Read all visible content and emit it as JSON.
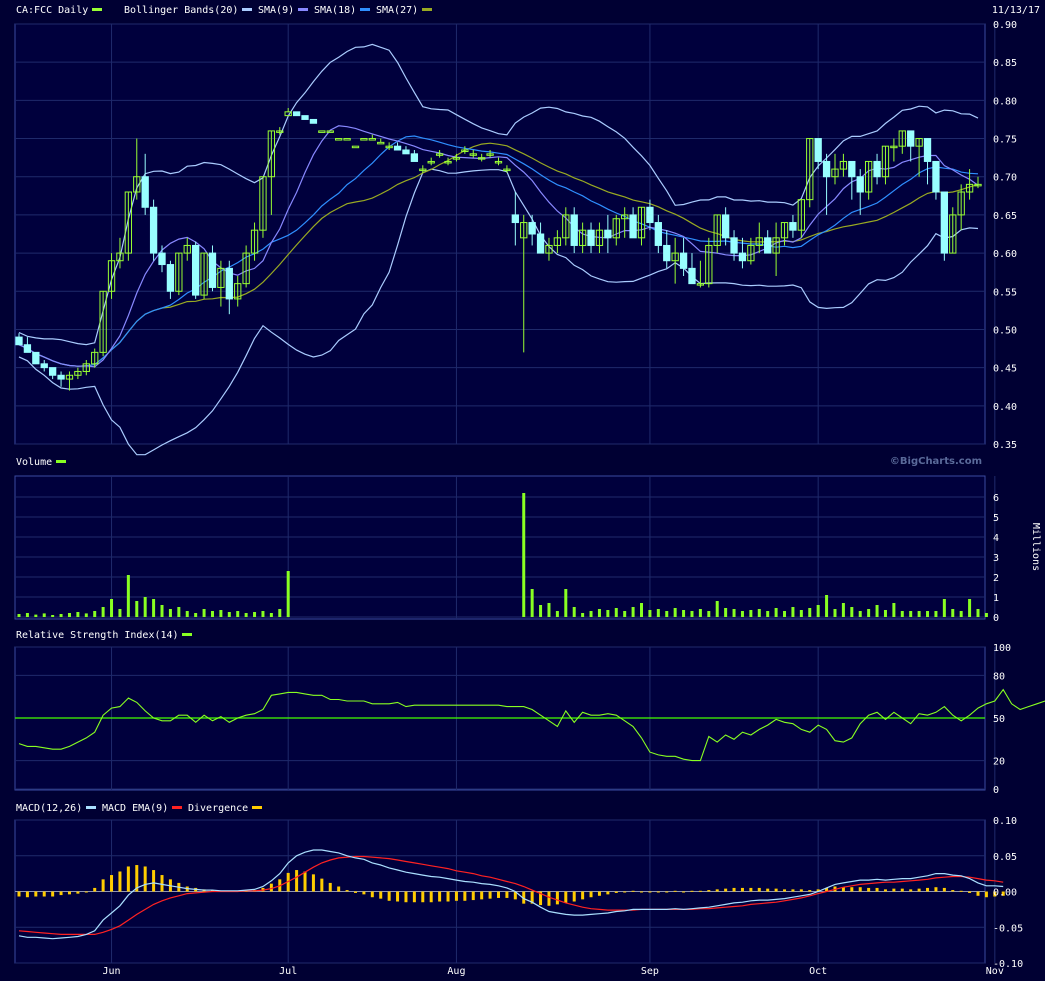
{
  "colors": {
    "background": "#000033",
    "panel_bg": "#00003d",
    "grid": "#1f2a6b",
    "up_candle": "#99ff33",
    "down_candle": "#99ffff",
    "bollinger": "#aaccff",
    "sma9": "#8888ff",
    "sma18": "#2f8fff",
    "sma27": "#99aa22",
    "volume": "#88ff22",
    "rsi": "#88ff22",
    "rsi_midline": "#44ff00",
    "macd": "#aadfff",
    "macd_ema": "#ff2222",
    "divergence": "#ffcc00"
  },
  "date_label": "11/13/17",
  "watermark": "©BigCharts.com",
  "x_labels": [
    {
      "i": 11,
      "text": "Jun"
    },
    {
      "i": 32,
      "text": "Jul"
    },
    {
      "i": 52,
      "text": "Aug"
    },
    {
      "i": 75,
      "text": "Sep"
    },
    {
      "i": 95,
      "text": "Oct"
    },
    {
      "i": 116,
      "text": "Nov"
    }
  ],
  "panels": {
    "price": {
      "legend": [
        {
          "text": "CA:FCC Daily",
          "color": "#99ff33"
        },
        {
          "text": "Bollinger Bands(20)",
          "color": "#aaccff"
        },
        {
          "text": "SMA(9)",
          "color": "#8888ff"
        },
        {
          "text": "SMA(18)",
          "color": "#2f8fff"
        },
        {
          "text": "SMA(27)",
          "color": "#99aa22"
        }
      ],
      "ymin": 0.35,
      "ymax": 0.9,
      "ticks": [
        "0.90",
        "0.85",
        "0.80",
        "0.75",
        "0.70",
        "0.65",
        "0.60",
        "0.55",
        "0.50",
        "0.45",
        "0.40",
        "0.35"
      ]
    },
    "volume": {
      "legend": [
        {
          "text": "Volume",
          "color": "#88ff22"
        }
      ],
      "ymax": 6.5,
      "ticks": [
        "6",
        "5",
        "4",
        "3",
        "2",
        "1",
        "0"
      ],
      "unit": "Millions"
    },
    "rsi": {
      "legend": [
        {
          "text": "Relative Strength Index(14)",
          "color": "#88ff22"
        }
      ],
      "ticks": [
        "100",
        "80",
        "50",
        "20",
        "0"
      ]
    },
    "macd": {
      "legend": [
        {
          "text": "MACD(12,26)",
          "color": "#aadfff"
        },
        {
          "text": "MACD EMA(9)",
          "color": "#ff2222"
        },
        {
          "text": "Divergence",
          "color": "#ffcc00"
        }
      ],
      "ymin": -0.1,
      "ymax": 0.1,
      "ticks": [
        "0.10",
        "0.05",
        "0.00",
        "-0.05",
        "-0.10"
      ]
    }
  },
  "chart_data": [
    {
      "type": "candlestick",
      "title": "CA:FCC Daily",
      "note": "Bollinger Bands(20), SMA(9), SMA(18), SMA(27)",
      "ohlc": [
        [
          0.49,
          0.495,
          0.48,
          0.48
        ],
        [
          0.48,
          0.49,
          0.47,
          0.47
        ],
        [
          0.47,
          0.47,
          0.455,
          0.455
        ],
        [
          0.455,
          0.46,
          0.445,
          0.45
        ],
        [
          0.45,
          0.45,
          0.435,
          0.44
        ],
        [
          0.44,
          0.445,
          0.425,
          0.435
        ],
        [
          0.435,
          0.445,
          0.42,
          0.44
        ],
        [
          0.44,
          0.45,
          0.435,
          0.445
        ],
        [
          0.445,
          0.46,
          0.44,
          0.455
        ],
        [
          0.455,
          0.475,
          0.45,
          0.47
        ],
        [
          0.47,
          0.55,
          0.465,
          0.55
        ],
        [
          0.55,
          0.6,
          0.54,
          0.59
        ],
        [
          0.59,
          0.62,
          0.58,
          0.6
        ],
        [
          0.6,
          0.68,
          0.59,
          0.68
        ],
        [
          0.68,
          0.75,
          0.67,
          0.7
        ],
        [
          0.7,
          0.73,
          0.65,
          0.66
        ],
        [
          0.66,
          0.67,
          0.59,
          0.6
        ],
        [
          0.6,
          0.61,
          0.575,
          0.585
        ],
        [
          0.585,
          0.59,
          0.54,
          0.55
        ],
        [
          0.55,
          0.6,
          0.545,
          0.6
        ],
        [
          0.6,
          0.62,
          0.59,
          0.61
        ],
        [
          0.61,
          0.615,
          0.54,
          0.545
        ],
        [
          0.545,
          0.6,
          0.54,
          0.6
        ],
        [
          0.6,
          0.61,
          0.55,
          0.555
        ],
        [
          0.555,
          0.59,
          0.53,
          0.58
        ],
        [
          0.58,
          0.59,
          0.52,
          0.54
        ],
        [
          0.54,
          0.57,
          0.53,
          0.56
        ],
        [
          0.56,
          0.61,
          0.555,
          0.6
        ],
        [
          0.6,
          0.64,
          0.59,
          0.63
        ],
        [
          0.63,
          0.7,
          0.62,
          0.7
        ],
        [
          0.7,
          0.76,
          0.65,
          0.76
        ],
        [
          0.76,
          0.765,
          0.755,
          0.76
        ],
        [
          0.78,
          0.79,
          0.785,
          0.785
        ],
        [
          0.785,
          0.785,
          0.78,
          0.78
        ],
        [
          0.78,
          0.78,
          0.775,
          0.775
        ],
        [
          0.775,
          0.775,
          0.77,
          0.77
        ],
        [
          0.76,
          0.76,
          0.76,
          0.76
        ],
        [
          0.76,
          0.76,
          0.76,
          0.76
        ],
        [
          0.75,
          0.75,
          0.75,
          0.75
        ],
        [
          0.75,
          0.75,
          0.75,
          0.75
        ],
        [
          0.74,
          0.74,
          0.74,
          0.74
        ],
        [
          0.75,
          0.75,
          0.75,
          0.75
        ],
        [
          0.75,
          0.755,
          0.75,
          0.75
        ],
        [
          0.745,
          0.75,
          0.745,
          0.745
        ],
        [
          0.74,
          0.745,
          0.735,
          0.74
        ],
        [
          0.74,
          0.745,
          0.735,
          0.735
        ],
        [
          0.735,
          0.74,
          0.73,
          0.73
        ],
        [
          0.73,
          0.735,
          0.725,
          0.72
        ],
        [
          0.71,
          0.715,
          0.705,
          0.71
        ],
        [
          0.72,
          0.725,
          0.715,
          0.72
        ],
        [
          0.73,
          0.735,
          0.725,
          0.73
        ],
        [
          0.72,
          0.725,
          0.715,
          0.72
        ],
        [
          0.725,
          0.73,
          0.72,
          0.725
        ],
        [
          0.735,
          0.74,
          0.73,
          0.735
        ],
        [
          0.73,
          0.735,
          0.725,
          0.73
        ],
        [
          0.725,
          0.73,
          0.72,
          0.725
        ],
        [
          0.73,
          0.735,
          0.725,
          0.73
        ],
        [
          0.72,
          0.725,
          0.715,
          0.72
        ],
        [
          0.71,
          0.715,
          0.705,
          0.71
        ],
        [
          0.65,
          0.68,
          0.61,
          0.64
        ],
        [
          0.62,
          0.65,
          0.47,
          0.64
        ],
        [
          0.64,
          0.65,
          0.61,
          0.625
        ],
        [
          0.625,
          0.64,
          0.6,
          0.6
        ],
        [
          0.6,
          0.62,
          0.59,
          0.61
        ],
        [
          0.61,
          0.63,
          0.6,
          0.62
        ],
        [
          0.62,
          0.66,
          0.61,
          0.65
        ],
        [
          0.65,
          0.66,
          0.6,
          0.61
        ],
        [
          0.61,
          0.64,
          0.6,
          0.63
        ],
        [
          0.63,
          0.64,
          0.6,
          0.61
        ],
        [
          0.61,
          0.64,
          0.6,
          0.63
        ],
        [
          0.63,
          0.65,
          0.6,
          0.62
        ],
        [
          0.62,
          0.65,
          0.61,
          0.645
        ],
        [
          0.645,
          0.66,
          0.62,
          0.65
        ],
        [
          0.65,
          0.66,
          0.62,
          0.62
        ],
        [
          0.62,
          0.66,
          0.61,
          0.66
        ],
        [
          0.66,
          0.67,
          0.63,
          0.64
        ],
        [
          0.64,
          0.65,
          0.6,
          0.61
        ],
        [
          0.61,
          0.63,
          0.58,
          0.59
        ],
        [
          0.59,
          0.62,
          0.56,
          0.6
        ],
        [
          0.6,
          0.62,
          0.57,
          0.58
        ],
        [
          0.58,
          0.6,
          0.56,
          0.56
        ],
        [
          0.56,
          0.59,
          0.555,
          0.56
        ],
        [
          0.56,
          0.62,
          0.555,
          0.61
        ],
        [
          0.61,
          0.65,
          0.6,
          0.65
        ],
        [
          0.65,
          0.66,
          0.61,
          0.62
        ],
        [
          0.62,
          0.63,
          0.59,
          0.6
        ],
        [
          0.6,
          0.62,
          0.58,
          0.59
        ],
        [
          0.59,
          0.62,
          0.585,
          0.61
        ],
        [
          0.61,
          0.64,
          0.6,
          0.62
        ],
        [
          0.62,
          0.63,
          0.6,
          0.6
        ],
        [
          0.6,
          0.64,
          0.57,
          0.62
        ],
        [
          0.62,
          0.64,
          0.61,
          0.64
        ],
        [
          0.64,
          0.65,
          0.62,
          0.63
        ],
        [
          0.63,
          0.67,
          0.62,
          0.67
        ],
        [
          0.67,
          0.75,
          0.66,
          0.75
        ],
        [
          0.75,
          0.75,
          0.71,
          0.72
        ],
        [
          0.72,
          0.73,
          0.65,
          0.7
        ],
        [
          0.7,
          0.73,
          0.69,
          0.71
        ],
        [
          0.71,
          0.73,
          0.7,
          0.72
        ],
        [
          0.72,
          0.72,
          0.67,
          0.7
        ],
        [
          0.7,
          0.71,
          0.65,
          0.68
        ],
        [
          0.68,
          0.72,
          0.67,
          0.72
        ],
        [
          0.72,
          0.73,
          0.69,
          0.7
        ],
        [
          0.7,
          0.74,
          0.69,
          0.74
        ],
        [
          0.74,
          0.75,
          0.72,
          0.74
        ],
        [
          0.74,
          0.76,
          0.73,
          0.76
        ],
        [
          0.76,
          0.76,
          0.72,
          0.74
        ],
        [
          0.74,
          0.75,
          0.7,
          0.75
        ],
        [
          0.75,
          0.75,
          0.69,
          0.72
        ],
        [
          0.72,
          0.72,
          0.67,
          0.68
        ],
        [
          0.68,
          0.68,
          0.59,
          0.6
        ],
        [
          0.6,
          0.66,
          0.6,
          0.65
        ],
        [
          0.65,
          0.69,
          0.63,
          0.68
        ],
        [
          0.68,
          0.71,
          0.67,
          0.69
        ],
        [
          0.69,
          0.7,
          0.685,
          0.69
        ]
      ],
      "volume_millions": [
        0.15,
        0.2,
        0.12,
        0.18,
        0.1,
        0.15,
        0.2,
        0.25,
        0.18,
        0.3,
        0.5,
        0.9,
        0.4,
        2.1,
        0.8,
        1.0,
        0.9,
        0.6,
        0.4,
        0.5,
        0.3,
        0.2,
        0.4,
        0.3,
        0.35,
        0.25,
        0.3,
        0.2,
        0.25,
        0.3,
        0.2,
        0.4,
        2.3,
        0,
        0,
        0,
        0,
        0,
        0,
        0,
        0,
        0,
        0,
        0,
        0,
        0,
        0,
        0,
        0,
        0,
        0,
        0,
        0,
        0,
        0,
        0,
        0,
        0,
        0,
        0,
        6.2,
        1.4,
        0.6,
        0.7,
        0.3,
        1.4,
        0.5,
        0.2,
        0.3,
        0.4,
        0.35,
        0.45,
        0.3,
        0.5,
        0.7,
        0.35,
        0.4,
        0.3,
        0.45,
        0.35,
        0.3,
        0.4,
        0.3,
        0.8,
        0.45,
        0.4,
        0.3,
        0.35,
        0.4,
        0.3,
        0.45,
        0.3,
        0.5,
        0.35,
        0.45,
        0.6,
        1.1,
        0.4,
        0.7,
        0.5,
        0.3,
        0.4,
        0.6,
        0.35,
        0.7,
        0.3,
        0.3,
        0.3,
        0.3,
        0.3,
        0.9,
        0.4,
        0.3,
        0.9,
        0.4,
        0.2
      ],
      "rsi": [
        32,
        30,
        30,
        29,
        28,
        28,
        30,
        33,
        36,
        40,
        52,
        57,
        58,
        64,
        61,
        55,
        50,
        48,
        48,
        52,
        52,
        47,
        52,
        48,
        51,
        47,
        50,
        52,
        53,
        56,
        66,
        67,
        68,
        68,
        67,
        66,
        66,
        63,
        63,
        62,
        62,
        62,
        60,
        60,
        60,
        61,
        58,
        59,
        59,
        59,
        59,
        59,
        59,
        59,
        59,
        59,
        59,
        59,
        58,
        58,
        58,
        56,
        52,
        48,
        44,
        55,
        47,
        54,
        52,
        52,
        53,
        52,
        48,
        44,
        36,
        26,
        24,
        23,
        23,
        21,
        20,
        20,
        37,
        33,
        38,
        35,
        40,
        38,
        42,
        45,
        49,
        47,
        46,
        42,
        40,
        45,
        42,
        34,
        33,
        36,
        46,
        52,
        54,
        49,
        54,
        50,
        46,
        53,
        52,
        54,
        58,
        52,
        48,
        52,
        57,
        60,
        62,
        70,
        60,
        56,
        58,
        60,
        62
      ],
      "macd": [
        -0.062,
        -0.064,
        -0.064,
        -0.065,
        -0.066,
        -0.065,
        -0.064,
        -0.063,
        -0.06,
        -0.055,
        -0.04,
        -0.03,
        -0.02,
        -0.005,
        0.005,
        0.01,
        0.012,
        0.01,
        0.008,
        0.006,
        0.004,
        0.003,
        0.002,
        0.002,
        0.001,
        0.001,
        0.001,
        0.002,
        0.003,
        0.007,
        0.015,
        0.025,
        0.04,
        0.05,
        0.055,
        0.058,
        0.058,
        0.056,
        0.054,
        0.05,
        0.047,
        0.045,
        0.04,
        0.037,
        0.033,
        0.03,
        0.027,
        0.025,
        0.023,
        0.021,
        0.02,
        0.018,
        0.016,
        0.014,
        0.013,
        0.011,
        0.01,
        0.008,
        0.005,
        0.0,
        -0.01,
        -0.015,
        -0.022,
        -0.028,
        -0.03,
        -0.032,
        -0.033,
        -0.033,
        -0.032,
        -0.031,
        -0.03,
        -0.028,
        -0.027,
        -0.025,
        -0.025,
        -0.025,
        -0.025,
        -0.025,
        -0.024,
        -0.025,
        -0.024,
        -0.023,
        -0.022,
        -0.02,
        -0.018,
        -0.016,
        -0.015,
        -0.013,
        -0.012,
        -0.012,
        -0.011,
        -0.01,
        -0.008,
        -0.006,
        -0.004,
        0.0,
        0.005,
        0.01,
        0.012,
        0.014,
        0.016,
        0.016,
        0.017,
        0.016,
        0.017,
        0.018,
        0.018,
        0.02,
        0.022,
        0.025,
        0.025,
        0.023,
        0.022,
        0.018,
        0.012,
        0.008,
        0.008,
        0.007
      ],
      "macd_ema": [
        -0.055,
        -0.056,
        -0.057,
        -0.058,
        -0.059,
        -0.06,
        -0.06,
        -0.06,
        -0.06,
        -0.06,
        -0.057,
        -0.053,
        -0.048,
        -0.04,
        -0.032,
        -0.025,
        -0.018,
        -0.013,
        -0.009,
        -0.006,
        -0.003,
        -0.002,
        -0.001,
        0.0,
        0.0,
        0.0,
        0.0,
        0.001,
        0.001,
        0.002,
        0.004,
        0.008,
        0.014,
        0.02,
        0.027,
        0.034,
        0.04,
        0.044,
        0.047,
        0.048,
        0.049,
        0.049,
        0.048,
        0.047,
        0.046,
        0.044,
        0.042,
        0.04,
        0.038,
        0.036,
        0.034,
        0.032,
        0.029,
        0.027,
        0.025,
        0.022,
        0.02,
        0.017,
        0.014,
        0.011,
        0.007,
        0.002,
        -0.003,
        -0.008,
        -0.012,
        -0.016,
        -0.019,
        -0.022,
        -0.024,
        -0.025,
        -0.026,
        -0.026,
        -0.026,
        -0.026,
        -0.025,
        -0.025,
        -0.025,
        -0.025,
        -0.025,
        -0.025,
        -0.025,
        -0.024,
        -0.024,
        -0.023,
        -0.022,
        -0.021,
        -0.02,
        -0.018,
        -0.017,
        -0.016,
        -0.015,
        -0.013,
        -0.011,
        -0.009,
        -0.006,
        -0.003,
        0.0,
        0.003,
        0.006,
        0.008,
        0.01,
        0.011,
        0.012,
        0.013,
        0.013,
        0.014,
        0.015,
        0.016,
        0.017,
        0.019,
        0.02,
        0.021,
        0.021,
        0.02,
        0.018,
        0.016,
        0.015,
        0.013
      ],
      "x_ticks": [
        "Jun",
        "Jul",
        "Aug",
        "Sep",
        "Oct",
        "Nov"
      ],
      "ylim": [
        0.35,
        0.9
      ]
    }
  ]
}
